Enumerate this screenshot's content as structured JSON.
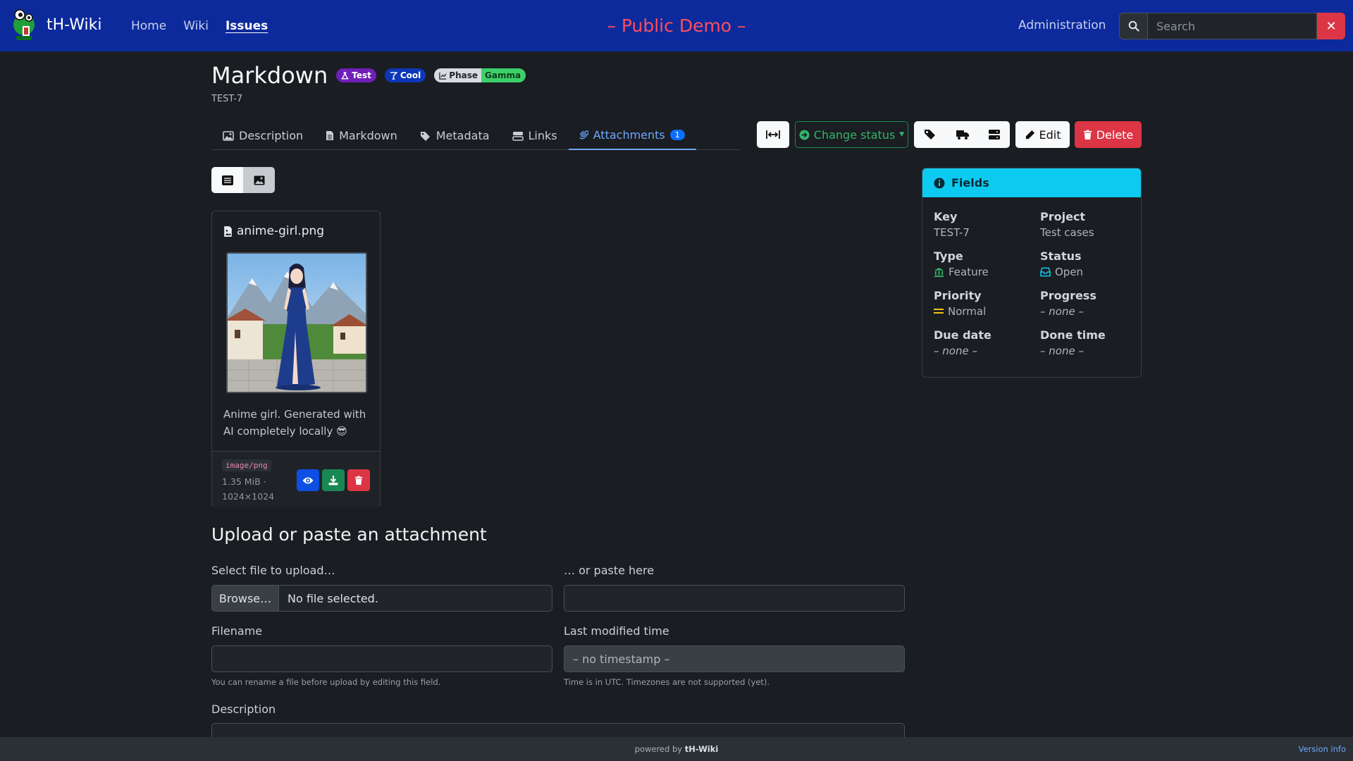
{
  "nav": {
    "brand": "tH-Wiki",
    "links": [
      "Home",
      "Wiki",
      "Issues"
    ],
    "active": "Issues",
    "demo": "– Public Demo –",
    "admin": "Administration",
    "search_placeholder": "Search"
  },
  "issue": {
    "title": "Markdown",
    "key": "TEST-7",
    "badges": {
      "test": "Test",
      "cool": "Cool",
      "phase_key": "Phase",
      "phase_value": "Gamma"
    }
  },
  "tabs": [
    "Description",
    "Markdown",
    "Metadata",
    "Links",
    "Attachments"
  ],
  "tabs_attachment_count": "1",
  "toolbar": {
    "change_status": "Change status",
    "edit": "Edit",
    "delete": "Delete"
  },
  "attachment": {
    "filename": "anime-girl.png",
    "description": "Anime girl. Generated with AI completely locally 😎",
    "mime": "image/png",
    "size": "1.35 MiB ·",
    "dimensions": "1024×1024"
  },
  "fields": {
    "header": "Fields",
    "key_label": "Key",
    "key_value": "TEST-7",
    "project_label": "Project",
    "project_value": "Test cases",
    "type_label": "Type",
    "type_value": "Feature",
    "status_label": "Status",
    "status_value": "Open",
    "priority_label": "Priority",
    "priority_value": "Normal",
    "progress_label": "Progress",
    "progress_value": "– none –",
    "due_label": "Due date",
    "due_value": "– none –",
    "done_label": "Done time",
    "done_value": "– none –"
  },
  "upload": {
    "title": "Upload or paste an attachment",
    "select_label": "Select file to upload…",
    "browse": "Browse…",
    "no_file": "No file selected.",
    "paste_label": "… or paste here",
    "filename_label": "Filename",
    "filename_help": "You can rename a file before upload by editing this field.",
    "modified_label": "Last modified time",
    "modified_placeholder": "– no timestamp –",
    "modified_help": "Time is in UTC. Timezones are not supported (yet).",
    "description_label": "Description"
  },
  "footer": {
    "powered": "powered by",
    "brand": "tH-Wiki",
    "version": "Version info"
  },
  "colors": {
    "navbar": "#0c2a9b",
    "accent": "#6ea8fe",
    "danger": "#dc3545",
    "info": "#0dcaf0"
  }
}
